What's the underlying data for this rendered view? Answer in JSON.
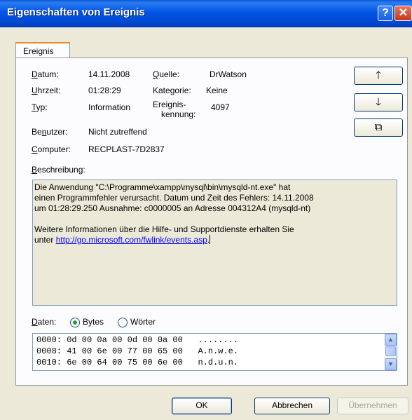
{
  "window": {
    "title": "Eigenschaften von Ereignis",
    "help_glyph": "?",
    "close_glyph": "✕"
  },
  "tab": {
    "label": "Ereignis"
  },
  "fields": {
    "datum_label": "Datum:",
    "datum_value": "14.11.2008",
    "quelle_label": "Quelle:",
    "quelle_value": "DrWatson",
    "uhrzeit_label": "Uhrzeit:",
    "uhrzeit_value": "01:28:29",
    "kategorie_label": "Kategorie:",
    "kategorie_value": "Keine",
    "typ_label": "Typ:",
    "typ_value": "Information",
    "kennung_label_1": "Ereignis-",
    "kennung_label_2": "kennung:",
    "kennung_value": "4097",
    "benutzer_label": "Benutzer:",
    "benutzer_value": "Nicht zutreffend",
    "computer_label": "Computer:",
    "computer_value": "RECPLAST-7D2837"
  },
  "side_buttons": {
    "up": "🡑",
    "down": "🡓",
    "copy": "⧉"
  },
  "description": {
    "label": "Beschreibung:",
    "line1": "Die Anwendung \"C:\\Programme\\xampp\\mysql\\bin\\mysqld-nt.exe\" hat",
    "line2": "einen Programmfehler verursacht. Datum und Zeit des Fehlers: 14.11.2008",
    "line3": "um 01:28:29.250 Ausnahme: c0000005 an Adresse 004312A4 (mysqld-nt)",
    "line4": "Weitere Informationen über die Hilfe- und Supportdienste erhalten Sie",
    "line5_prefix": "unter ",
    "link": "http://go.microsoft.com/fwlink/events.asp",
    "line5_suffix": "."
  },
  "data_section": {
    "label": "Daten:",
    "option_bytes": "Bytes",
    "option_words": "Wörter",
    "selected": "Bytes",
    "hex_lines": [
      "0000: 0d 00 0a 00 0d 00 0a 00   ........",
      "0008: 41 00 6e 00 77 00 65 00   A.n.w.e.",
      "0010: 6e 00 64 00 75 00 6e 00   n.d.u.n."
    ]
  },
  "buttons": {
    "ok": "OK",
    "cancel": "Abbrechen",
    "apply": "Übernehmen"
  }
}
